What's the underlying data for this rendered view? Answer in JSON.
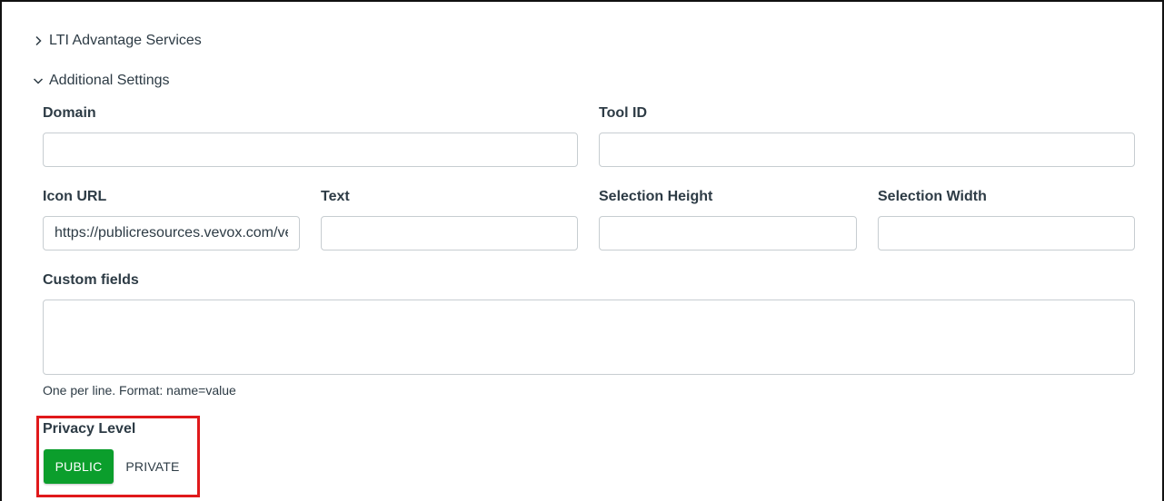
{
  "sections": {
    "lti_advantage": {
      "label": "LTI Advantage Services",
      "state": "collapsed"
    },
    "additional_settings": {
      "label": "Additional Settings",
      "state": "expanded"
    }
  },
  "fields": {
    "domain": {
      "label": "Domain",
      "value": ""
    },
    "tool_id": {
      "label": "Tool ID",
      "value": ""
    },
    "icon_url": {
      "label": "Icon URL",
      "value": "https://publicresources.vevox.com/vevox"
    },
    "text": {
      "label": "Text",
      "value": ""
    },
    "selection_height": {
      "label": "Selection Height",
      "value": ""
    },
    "selection_width": {
      "label": "Selection Width",
      "value": ""
    },
    "custom_fields": {
      "label": "Custom fields",
      "value": "",
      "hint": "One per line. Format: name=value"
    }
  },
  "privacy": {
    "label": "Privacy Level",
    "options": [
      {
        "label": "PUBLIC",
        "selected": true
      },
      {
        "label": "PRIVATE",
        "selected": false
      }
    ]
  },
  "colors": {
    "selected_green": "#0b9e2c",
    "highlight_red": "#e0191b",
    "text": "#2d3b45",
    "input_border": "#c7cdd1"
  }
}
